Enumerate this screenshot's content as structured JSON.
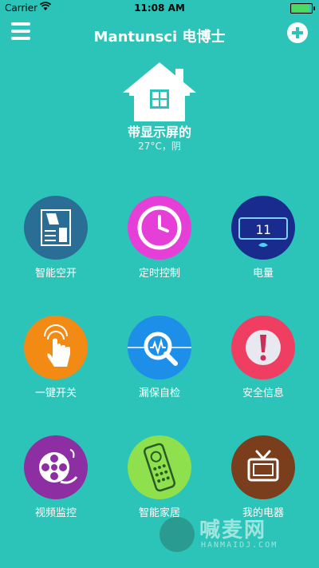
{
  "status": {
    "carrier": "Carrier",
    "time": "11:08 AM"
  },
  "header": {
    "title": "Mantunsci 电博士"
  },
  "location": {
    "name": "带显示屏的",
    "weather": "27°C，阴"
  },
  "grid_items": [
    {
      "label": "智能空开",
      "icon": "circuit-breaker-icon",
      "color": "#2a6e95"
    },
    {
      "label": "定时控制",
      "icon": "clock-icon",
      "color": "#e63fd7"
    },
    {
      "label": "电量",
      "icon": "digital-meter-icon",
      "color": "#1a2b8e"
    },
    {
      "label": "一键开关",
      "icon": "touch-hand-icon",
      "color": "#f38a14"
    },
    {
      "label": "漏保自检",
      "icon": "magnifier-wave-icon",
      "color": "#1d8fe8"
    },
    {
      "label": "安全信息",
      "icon": "warning-icon",
      "color": "#f03e63"
    },
    {
      "label": "视频监控",
      "icon": "film-reel-icon",
      "color": "#8e2ea3"
    },
    {
      "label": "智能家居",
      "icon": "remote-control-icon",
      "color": "#8ee04c"
    },
    {
      "label": "我的电器",
      "icon": "tv-icon",
      "color": "#7a3e1c"
    }
  ],
  "meter_value": "11",
  "watermark": {
    "text": "喊麦网",
    "sub": "HANMAIDJ.COM"
  },
  "colors": {
    "background": "#2cc4b8",
    "accent": "#ffffff"
  }
}
